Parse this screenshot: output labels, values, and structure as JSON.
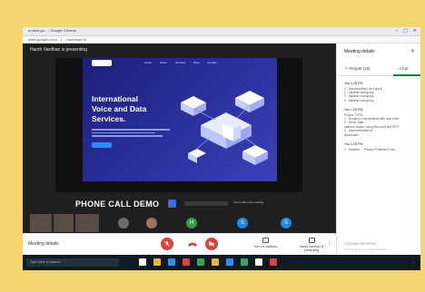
{
  "window": {
    "title": "a.meet.go... - Google Chrome",
    "url": "meet.google.com/... | ...?authuser=0"
  },
  "meeting": {
    "presenter_banner": "Harsh Vardhan is presenting",
    "caption": "PHONE CALL DEMO",
    "mini_note": "You're still in the meeting",
    "meeting_details": "Meeting details",
    "controls": {
      "mic_icon": "mic-off-icon",
      "hangup_icon": "call-end-icon",
      "camera_icon": "camera-off-icon",
      "captions_label": "Turn on captions",
      "present_label": "Harsh Vardhan is presenting",
      "more_icon": "more-vert-icon"
    },
    "participants": [
      {
        "type": "video"
      },
      {
        "type": "video"
      },
      {
        "type": "video"
      },
      {
        "type": "avatar",
        "letter": "",
        "color": "#6b6b6b"
      },
      {
        "type": "avatar",
        "letter": "",
        "color": "#a07060"
      },
      {
        "type": "avatar",
        "letter": "H",
        "color": "#2e9d4a"
      },
      {
        "type": "avatar",
        "letter": "S",
        "color": "#1e88e5"
      },
      {
        "type": "avatar",
        "letter": "S",
        "color": "#1e88e5"
      }
    ]
  },
  "slide": {
    "menu": [
      "Home",
      "About",
      "Services",
      "Blog",
      "Contact"
    ],
    "headline_1": "International",
    "headline_2": "Voice and Data",
    "headline_3": "Services."
  },
  "panel": {
    "title": "Meeting details",
    "tabs": [
      {
        "label": "People (18)",
        "icon": "people-icon",
        "active": false
      },
      {
        "label": "Chat",
        "icon": "chat-icon",
        "active": true
      }
    ],
    "messages": [
      {
        "who": "You 1:25 PM",
        "lines": [
          "1 - Harshvardhan, and group",
          "2 - Vardhan and group",
          "3 - Vardhan and group",
          "4 - Vardhan and group"
        ]
      },
      {
        "who": "You 1:25 PM",
        "lines": [
          "Project TYRO:",
          "1 - Dynamic Cost analysis with user rules",
          "2 - Demo Task...",
          "platform shape, using Microsoft and IPFS",
          "3 - Implementation of ...",
          "Blockchain"
        ]
      },
      {
        "who": "You 1:25 PM",
        "lines": [
          "4 - Weather ... Privacy Protected Chat..."
        ]
      }
    ],
    "activate_title": "Activate Windows",
    "activate_sub": "Go to Settings to activate Windows."
  },
  "taskbar": {
    "search_placeholder": "Type here to search",
    "tray_time": "...",
    "icon_colors": [
      "#ffffff",
      "#f0b429",
      "#2d8cff",
      "#e0413a",
      "#34a853",
      "#f0b429",
      "#2d8cff",
      "#34a853",
      "#ffffff",
      "#e0413a"
    ]
  },
  "colors": {
    "accent": "#0b8043",
    "hangup": "#e0413a",
    "slide_bg": "#2a2f9c"
  }
}
